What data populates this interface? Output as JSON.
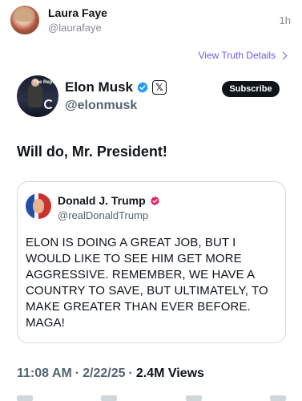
{
  "truth_post": {
    "display_name": "Laura Faye",
    "handle": "@laurafaye",
    "time": "1h",
    "view_details_label": "View Truth Details"
  },
  "x_post": {
    "display_name": "Elon Musk",
    "handle": "@elonmusk",
    "subscribe_label": "Subscribe",
    "avatar_tag": "The Repo",
    "text": "Will do, Mr. President!",
    "time": "11:08 AM",
    "date": "2/22/25",
    "separator": "·",
    "views": "2.4M Views"
  },
  "quoted_truth": {
    "display_name": "Donald J. Trump",
    "handle": "@realDonaldTrump",
    "body": "ELON IS DOING A GREAT JOB, BUT I WOULD LIKE TO SEE HIM GET MORE AGGRESSIVE. REMEMBER, WE HAVE A COUNTRY TO SAVE, BUT ULTIMATELY, TO MAKE GREATER THAN EVER BEFORE. MAGA!"
  },
  "colors": {
    "accent": "#6c5ce7",
    "x_verified": "#1d9bf0",
    "truth_verified": "#e0245e"
  },
  "icons": [
    "verified-badge-icon",
    "x-logo-icon",
    "chevron-right-icon",
    "truth-verified-icon"
  ]
}
